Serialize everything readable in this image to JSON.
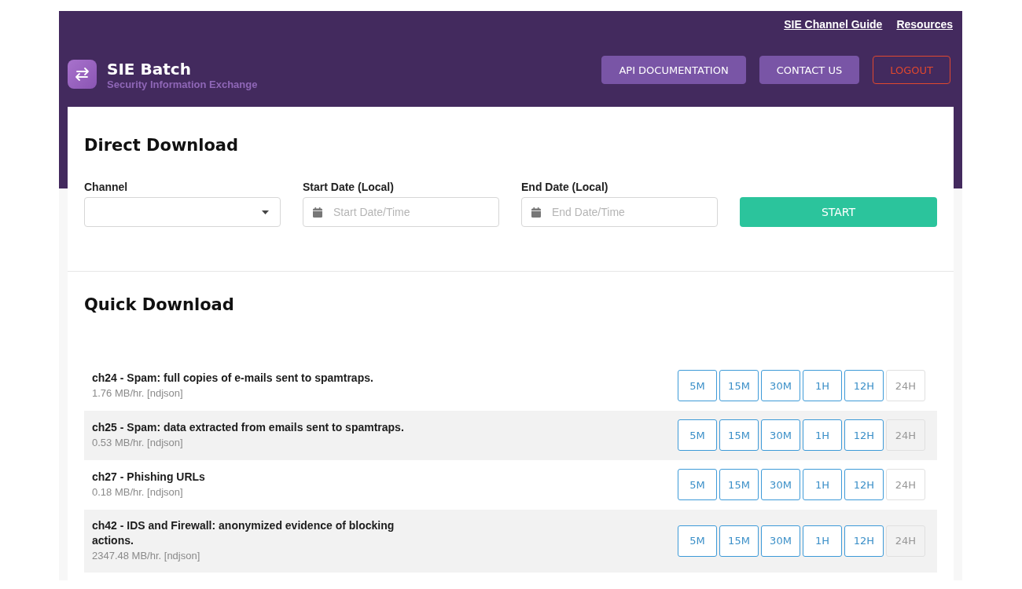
{
  "header": {
    "links": [
      "SIE Channel Guide",
      "Resources"
    ],
    "brand": {
      "title": "SIE Batch",
      "subtitle": "Security Information Exchange"
    },
    "buttons": [
      {
        "label": "API DOCUMENTATION",
        "kind": "filled"
      },
      {
        "label": "CONTACT US",
        "kind": "filled"
      },
      {
        "label": "LOGOUT",
        "kind": "outline"
      }
    ]
  },
  "direct_download": {
    "title": "Direct Download",
    "fields": [
      {
        "label": "Channel",
        "kind": "select"
      },
      {
        "label": "Start Date (Local)",
        "kind": "date",
        "placeholder": "Start Date/Time"
      },
      {
        "label": "End Date (Local)",
        "kind": "date",
        "placeholder": "End Date/Time"
      }
    ],
    "button": "START"
  },
  "quick_download": {
    "title": "Quick Download",
    "channels": [
      {
        "title": "ch24 - Spam: full copies of e-mails sent to spamtraps.",
        "rate": "1.76 MB/hr. [ndjson]",
        "durations": [
          {
            "label": "5M",
            "disabled": false
          },
          {
            "label": "15M",
            "disabled": false
          },
          {
            "label": "30M",
            "disabled": false
          },
          {
            "label": "1H",
            "disabled": false
          },
          {
            "label": "12H",
            "disabled": false
          },
          {
            "label": "24H",
            "disabled": true
          }
        ]
      },
      {
        "title": "ch25 - Spam: data extracted from emails sent to spamtraps.",
        "rate": "0.53 MB/hr. [ndjson]",
        "durations": [
          {
            "label": "5M",
            "disabled": false
          },
          {
            "label": "15M",
            "disabled": false
          },
          {
            "label": "30M",
            "disabled": false
          },
          {
            "label": "1H",
            "disabled": false
          },
          {
            "label": "12H",
            "disabled": false
          },
          {
            "label": "24H",
            "disabled": true
          }
        ]
      },
      {
        "title": "ch27 - Phishing URLs",
        "rate": "0.18 MB/hr. [ndjson]",
        "durations": [
          {
            "label": "5M",
            "disabled": false
          },
          {
            "label": "15M",
            "disabled": false
          },
          {
            "label": "30M",
            "disabled": false
          },
          {
            "label": "1H",
            "disabled": false
          },
          {
            "label": "12H",
            "disabled": false
          },
          {
            "label": "24H",
            "disabled": true
          }
        ]
      },
      {
        "title": "ch42 - IDS and Firewall: anonymized evidence of blocking actions.",
        "rate": "2347.48 MB/hr. [ndjson]",
        "durations": [
          {
            "label": "5M",
            "disabled": false
          },
          {
            "label": "15M",
            "disabled": false
          },
          {
            "label": "30M",
            "disabled": false
          },
          {
            "label": "1H",
            "disabled": false
          },
          {
            "label": "12H",
            "disabled": false
          },
          {
            "label": "24H",
            "disabled": true
          }
        ]
      }
    ]
  }
}
